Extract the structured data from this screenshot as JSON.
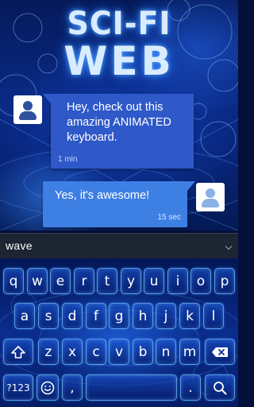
{
  "theme": {
    "name_line1": "SCI-FI",
    "name_line2": "WEB"
  },
  "chat": {
    "incoming": {
      "text": "Hey, check out this amazing ANIMATED keyboard.",
      "time": "1 min"
    },
    "outgoing": {
      "text": "Yes, it's awesome!",
      "time": "15 sec"
    }
  },
  "suggestion": {
    "word": "wave"
  },
  "keyboard": {
    "row1": [
      "q",
      "w",
      "e",
      "r",
      "t",
      "y",
      "u",
      "i",
      "o",
      "p"
    ],
    "row2": [
      "a",
      "s",
      "d",
      "f",
      "g",
      "h",
      "j",
      "k",
      "l"
    ],
    "row3": [
      "z",
      "x",
      "c",
      "v",
      "b",
      "n",
      "m"
    ],
    "symbols_label": "?123",
    "comma": ",",
    "period": ".",
    "icons": {
      "shift": "shift-icon",
      "backspace": "backspace-icon",
      "emoji": "emoji-icon",
      "space": "spacebar",
      "search": "search-icon"
    }
  },
  "colors": {
    "incoming_bubble": "#2f59c8",
    "outgoing_bubble": "#3e7fe4",
    "key_border": "#78beff",
    "suggest_bar": "#1e2532"
  }
}
